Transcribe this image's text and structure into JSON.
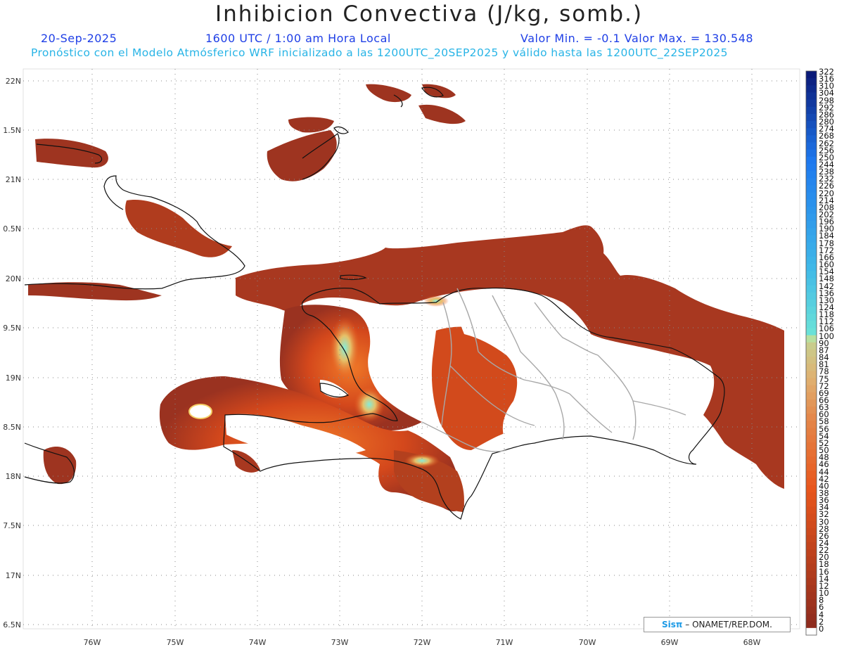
{
  "title": "Inhibicion Convectiva (J/kg, somb.)",
  "header": {
    "date": "20-Sep-2025",
    "time": "1600 UTC / 1:00 am Hora Local",
    "minmax": "Valor Min. = -0.1  Valor Max. = 130.548",
    "forecast": "Pronóstico con el Modelo Atmósferico WRF inicializado a las 1200UTC_20SEP2025 y válido hasta las  1200UTC_22SEP2025"
  },
  "axes": {
    "lat_labels": [
      "22N",
      "1.5N",
      "21N",
      "0.5N",
      "20N",
      "9.5N",
      "19N",
      "8.5N",
      "18N",
      "7.5N",
      "17N",
      "6.5N"
    ],
    "lon_labels": [
      "76W",
      "75W",
      "74W",
      "73W",
      "72W",
      "71W",
      "70W",
      "69W",
      "68W"
    ]
  },
  "colorbar": {
    "labels": [
      "322",
      "316",
      "310",
      "304",
      "298",
      "292",
      "286",
      "280",
      "274",
      "268",
      "262",
      "256",
      "250",
      "244",
      "238",
      "232",
      "226",
      "220",
      "214",
      "208",
      "202",
      "196",
      "190",
      "184",
      "178",
      "172",
      "166",
      "160",
      "154",
      "148",
      "142",
      "136",
      "130",
      "124",
      "118",
      "112",
      "106",
      "100",
      "90",
      "87",
      "84",
      "81",
      "78",
      "75",
      "72",
      "69",
      "66",
      "63",
      "60",
      "58",
      "56",
      "54",
      "52",
      "50",
      "48",
      "46",
      "44",
      "42",
      "40",
      "38",
      "36",
      "34",
      "32",
      "30",
      "28",
      "26",
      "24",
      "22",
      "20",
      "18",
      "16",
      "14",
      "12",
      "10",
      "8",
      "6",
      "4",
      "2",
      "0"
    ],
    "colors": {
      "low": "#8a2a1e",
      "mid": "#e8561c",
      "green": "#b8e0a0",
      "cyan": "#6fe6d6",
      "blue": "#1e78ee",
      "navy": "#0a1a78"
    }
  },
  "credit": {
    "logo": "Sisπ",
    "text": "– ONAMET/REP.DOM."
  }
}
